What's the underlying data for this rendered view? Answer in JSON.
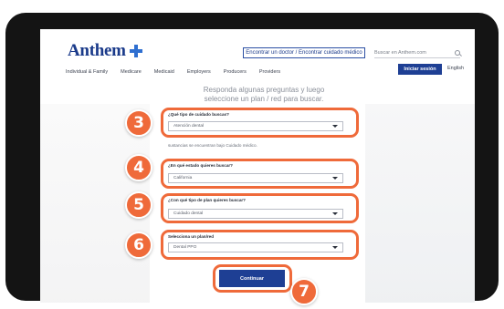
{
  "header": {
    "logo_text": "Anthem",
    "find_doctor_label": "Encontrar un doctor / Encontrar cuidado médico",
    "search_placeholder": "Buscar en Anthem.com",
    "signin_label": "Iniciar sesión",
    "language_label": "English",
    "nav_items": [
      "Individual & Family",
      "Medicare",
      "Medicaid",
      "Employers",
      "Producers",
      "Providers"
    ]
  },
  "intro_text": "Responda algunas preguntas y luego seleccione un plan / red para buscar.",
  "form": {
    "care_type": {
      "label": "¿Qué tipo de cuidado buscas?",
      "value": "Atención dental"
    },
    "note": "sustancias se encuentran bajo Cuidado médico.",
    "state": {
      "label": "¿En qué estado quieres buscar?",
      "value": "California"
    },
    "plan_type": {
      "label": "¿Con qué tipo de plan quieres buscar?",
      "value": "Cuidado dental"
    },
    "plan_network": {
      "label": "Selecciona un plan/red",
      "value": "Dental PPO"
    },
    "continue_label": "Continuar"
  },
  "steps": [
    "3",
    "4",
    "5",
    "6",
    "7"
  ],
  "colors": {
    "accent_orange": "#ef6a3a",
    "brand_blue": "#1e3f94"
  }
}
